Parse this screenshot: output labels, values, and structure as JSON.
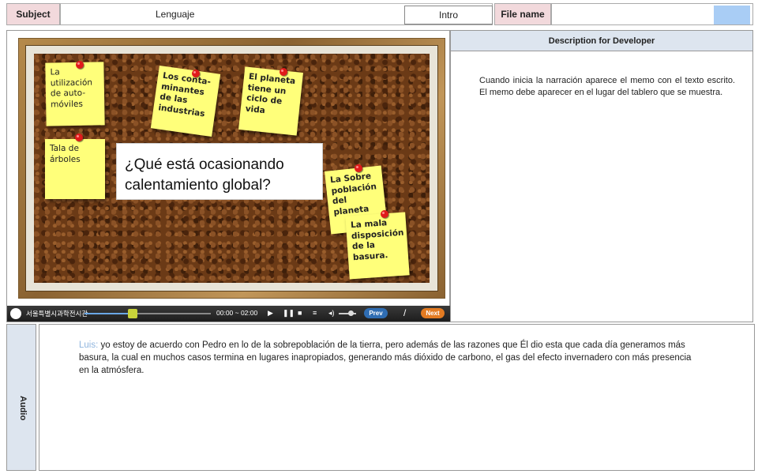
{
  "header": {
    "subject_label": "Subject",
    "subject_value": "Lenguaje",
    "intro_label": "Intro",
    "file_label": "File name",
    "file_swatch_color": "#a9cdf5"
  },
  "board": {
    "question": "¿Qué está ocasionando calentamiento global?",
    "notes": [
      {
        "text": "La utilización de auto-móviles"
      },
      {
        "text": "Los conta-minantes de las industrias"
      },
      {
        "text": "El planeta tiene un ciclo de vida"
      },
      {
        "text": "Tala de árboles"
      },
      {
        "text": "La Sobre población del planeta"
      },
      {
        "text": "La mala disposición de la basura."
      }
    ]
  },
  "player": {
    "brand": "서울특별시과학전시관",
    "time": "00:00 ~ 02:00",
    "progress": 0.38,
    "prev_label": "Prev",
    "separator": "/",
    "next_label": "Next",
    "icons": [
      "play-icon",
      "pause-icon",
      "stop-icon",
      "list-icon",
      "volume-icon"
    ]
  },
  "description": {
    "title": "Description for Developer",
    "text": "Cuando inicia la narración aparece el memo con el texto escrito. El memo debe aparecer en el lugar del tablero que se muestra."
  },
  "audio": {
    "label": "Audio",
    "speaker": "Luis:",
    "text": " yo estoy de acuerdo con Pedro en lo de la sobrepoblación de la tierra, pero además de las razones que Él dio esta que cada día generamos más basura, la cual en muchos casos termina en lugares inapropiados, generando más dióxido de carbono, el gas del efecto invernadero con más presencia en la atmósfera.",
    "speaker_color": "#8fb5de"
  }
}
